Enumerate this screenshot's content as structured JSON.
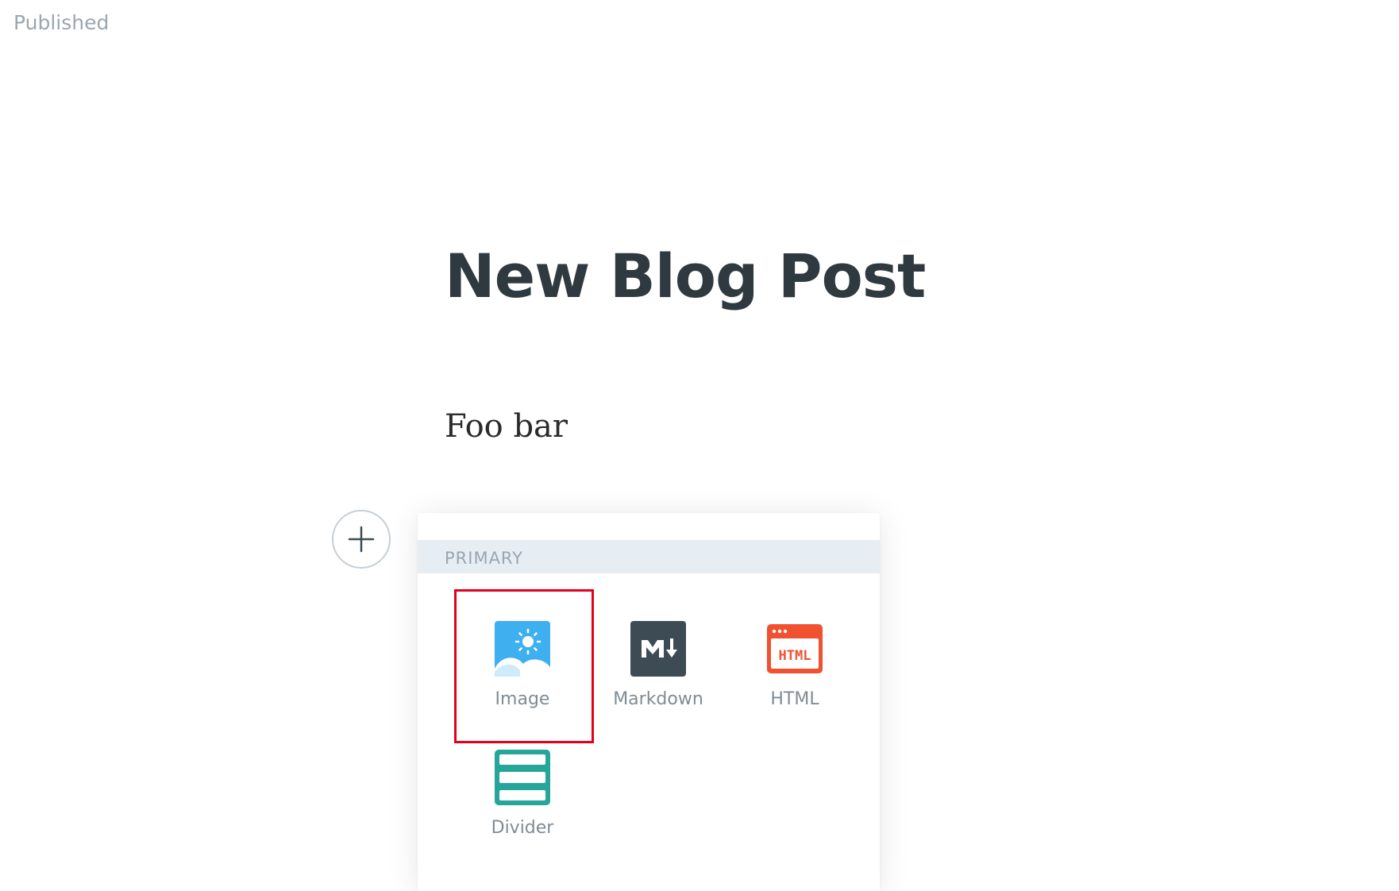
{
  "status": "Published",
  "post": {
    "title": "New Blog Post",
    "body": "Foo bar"
  },
  "card_menu": {
    "section_label": "PRIMARY",
    "items": [
      {
        "label": "Image",
        "icon": "image-icon",
        "color": "#3eb0ef"
      },
      {
        "label": "Markdown",
        "icon": "markdown-icon",
        "color": "#3d4b54"
      },
      {
        "label": "HTML",
        "icon": "html-icon",
        "color": "#f05230"
      },
      {
        "label": "Divider",
        "icon": "divider-icon",
        "color": "#26a69a"
      }
    ],
    "selected_item": "Image"
  },
  "plus_button": {
    "icon": "plus-icon"
  }
}
